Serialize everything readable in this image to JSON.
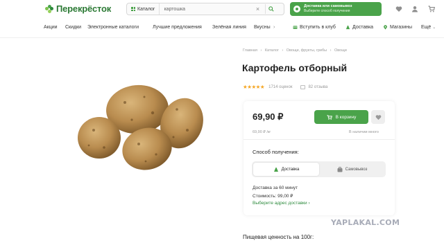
{
  "header": {
    "logo_text": "Перекрёсток",
    "catalog_label": "Каталог",
    "search_value": "картошка",
    "delivery_banner": {
      "line1": "Доставка или самовывоз",
      "line2": "Выберите способ получения"
    },
    "icons": [
      "heart-icon",
      "user-icon",
      "cart-icon"
    ],
    "brand_color": "#4aa34a"
  },
  "nav": {
    "items": [
      "Акции",
      "Скидки",
      "Электронные каталоги",
      "Лучшие предложения",
      "Зелёная линия",
      "Вкусны"
    ],
    "more_arrow": "›",
    "right_items": [
      "Вступить в клуб",
      "Доставка",
      "Магазины"
    ],
    "more_label": "Ещё"
  },
  "breadcrumb": [
    "Главная",
    "›",
    "Каталог",
    "›",
    "Овощи, фрукты, грибы",
    "›",
    "Овощи"
  ],
  "product": {
    "title": "Картофель отборный",
    "stars": "★★★★★",
    "ratings_count": "1714 оценок",
    "reviews_count": "82 отзыва",
    "price": "69,90 ₽",
    "unit_price": "69,90 ₽ /кг",
    "cart_label": "В корзину",
    "stock": "В наличии много"
  },
  "delivery": {
    "label": "Способ получения:",
    "options": [
      "Доставка",
      "Самовывоз"
    ],
    "time": "Доставка за 60 минут",
    "cost": "Стоимость: 99,00 ₽",
    "link": "Выберите адрес доставки ›"
  },
  "nutrition_label": "Пищевая ценность на 100г:",
  "watermark": "YAPLAKAL.COM"
}
